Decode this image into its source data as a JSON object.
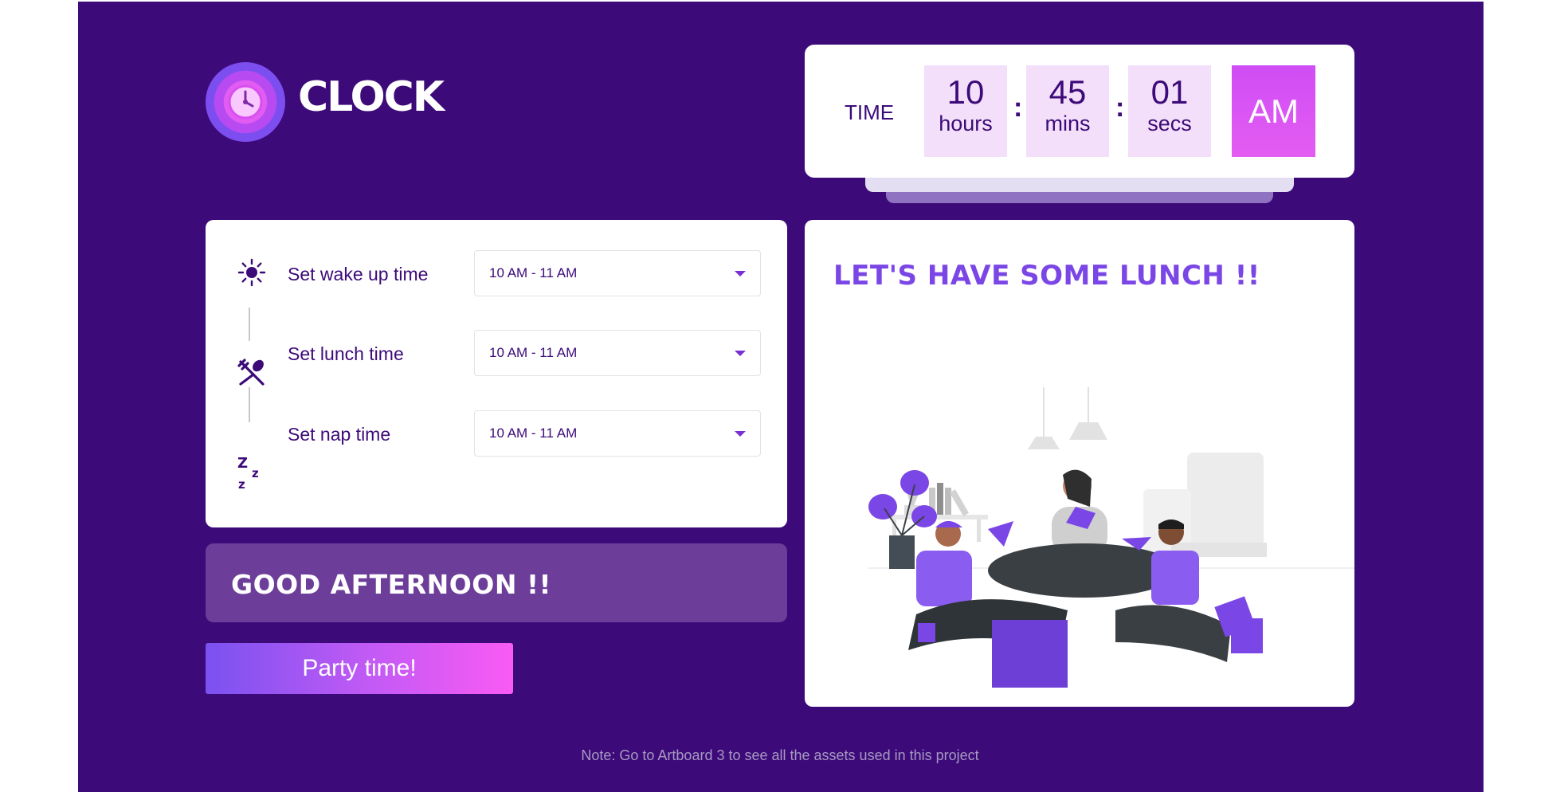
{
  "app": {
    "title": "CLOCK",
    "logo_icon": "clock-icon"
  },
  "time": {
    "label": "TIME",
    "hours": {
      "value": "10",
      "unit": "hours"
    },
    "minutes": {
      "value": "45",
      "unit": "mins"
    },
    "seconds": {
      "value": "01",
      "unit": "secs"
    },
    "separator": ":",
    "period": "AM"
  },
  "settings": {
    "rows": [
      {
        "icon": "sun-icon",
        "label": "Set wake up time",
        "value": "10 AM - 11 AM"
      },
      {
        "icon": "fork-spoon-icon",
        "label": "Set lunch time",
        "value": "10 AM - 11 AM"
      },
      {
        "icon": "zzz-icon",
        "label": "Set nap time",
        "value": "10 AM - 11 AM"
      }
    ]
  },
  "greeting": "GOOD AFTERNOON !!",
  "party_button": "Party time!",
  "lunch": {
    "title": "LET'S HAVE SOME LUNCH !!",
    "illustration": "friends-eating-pizza-illustration"
  },
  "note": "Note: Go to Artboard 3 to see all the assets used in this project",
  "colors": {
    "background": "#3c0a79",
    "accent": "#e45cf2",
    "lunch_title": "#7b46e6",
    "greeting_bg": "#6c3d99"
  }
}
